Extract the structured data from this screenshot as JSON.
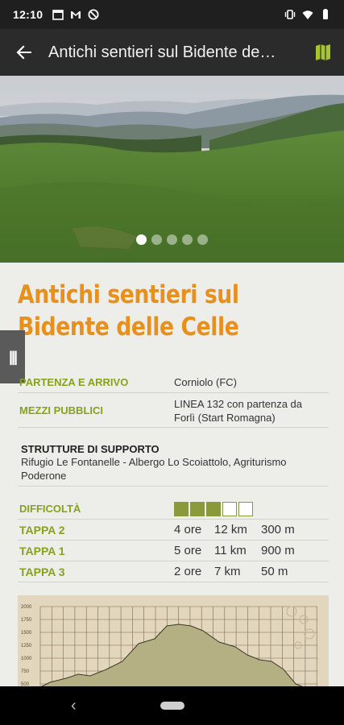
{
  "status_bar": {
    "time": "12:10",
    "left_icons": [
      "calendar-icon",
      "gmail-icon",
      "no-disturb-icon"
    ],
    "right_icons": [
      "vibrate-icon",
      "wifi-icon",
      "battery-icon"
    ]
  },
  "app_bar": {
    "title": "Antichi sentieri sul Bidente de…",
    "back_icon": "arrow-left-icon",
    "map_icon": "map-icon",
    "accent": "#a7c431"
  },
  "gallery": {
    "slide_count": 5,
    "active_index": 0
  },
  "content": {
    "title_line1": "Antichi sentieri sul",
    "title_line2": "Bidente delle Celle",
    "title_color": "#e8901c",
    "label_color": "#86a21d",
    "partenza": {
      "label": "PARTENZA E ARRIVO",
      "value": "Corniolo (FC)"
    },
    "mezzi": {
      "label": "MEZZI PUBBLICI",
      "value_line1": "LINEA 132 con partenza da",
      "value_line2": "Forlì (Start Romagna)"
    },
    "strutture": {
      "label": "STRUTTURE DI SUPPORTO",
      "value_line1": "Rifugio Le Fontanelle - Albergo Lo Scoiattolo, Agriturismo",
      "value_line2": "Poderone"
    },
    "difficolta": {
      "label": "DIFFICOLTÀ",
      "level": 3,
      "max": 5
    },
    "tappe": [
      {
        "label": "TAPPA 2",
        "time": "4 ore",
        "distance": "12 km",
        "elevation": "300 m"
      },
      {
        "label": "TAPPA 1",
        "time": "5 ore",
        "distance": "11 km",
        "elevation": "900 m"
      },
      {
        "label": "TAPPA 3",
        "time": "2 ore",
        "distance": "7 km",
        "elevation": "50 m"
      }
    ]
  },
  "elevation_profile": {
    "y_ticks": [
      "2000",
      "1750",
      "1500",
      "1250",
      "1000",
      "750",
      "500"
    ]
  },
  "nav_bar": {
    "back_icon": "nav-back-icon",
    "home_icon": "nav-home-pill"
  }
}
